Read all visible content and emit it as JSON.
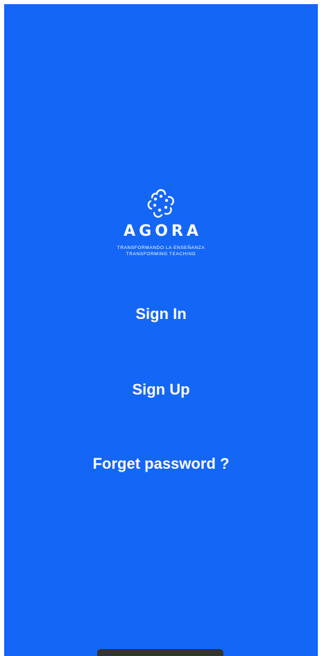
{
  "colors": {
    "background": "#1466f7",
    "text": "#ffffff"
  },
  "logo": {
    "icon": "agora-flower-icon",
    "brand": "AGORA",
    "tagline_es": "TRANSFORMANDO LA ENSEÑANZA",
    "tagline_en": "TRANSFORMING TEACHING"
  },
  "actions": {
    "sign_in": "Sign In",
    "sign_up": "Sign Up",
    "forgot_password": "Forget password ?"
  }
}
